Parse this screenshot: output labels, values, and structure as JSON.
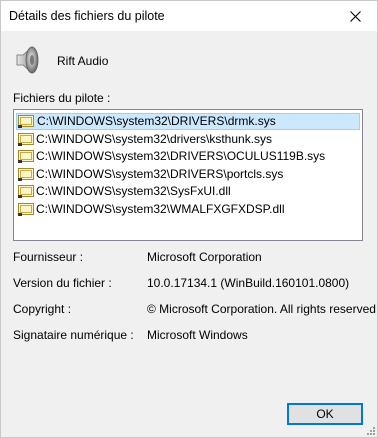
{
  "window": {
    "title": "Détails des fichiers du pilote",
    "close_icon": "close-icon"
  },
  "device": {
    "icon": "speaker-icon",
    "name": "Rift Audio"
  },
  "files": {
    "label": "Fichiers du pilote :",
    "selected_index": 0,
    "items": [
      "C:\\WINDOWS\\system32\\DRIVERS\\drmk.sys",
      "C:\\WINDOWS\\system32\\drivers\\ksthunk.sys",
      "C:\\WINDOWS\\system32\\DRIVERS\\OCULUS119B.sys",
      "C:\\WINDOWS\\system32\\DRIVERS\\portcls.sys",
      "C:\\WINDOWS\\system32\\SysFxUI.dll",
      "C:\\WINDOWS\\system32\\WMALFXGFXDSP.dll"
    ]
  },
  "details": {
    "provider_label": "Fournisseur :",
    "provider_value": "Microsoft Corporation",
    "version_label": "Version du fichier :",
    "version_value": "10.0.17134.1 (WinBuild.160101.0800)",
    "copyright_label": "Copyright :",
    "copyright_value": "© Microsoft Corporation. All rights reserved.",
    "signer_label": "Signataire numérique :",
    "signer_value": "Microsoft Windows"
  },
  "buttons": {
    "ok_label": "OK"
  },
  "colors": {
    "selection_bg": "#cce8ff",
    "selection_border": "#99d1ff",
    "accent": "#0078d7"
  }
}
